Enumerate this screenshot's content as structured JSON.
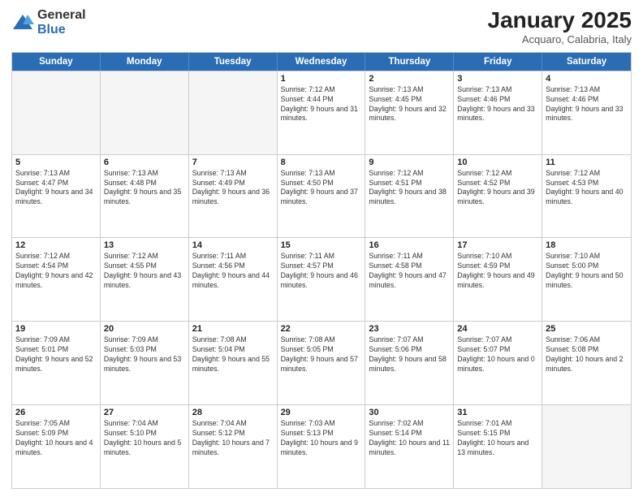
{
  "header": {
    "logo_general": "General",
    "logo_blue": "Blue",
    "month_title": "January 2025",
    "subtitle": "Acquaro, Calabria, Italy"
  },
  "calendar": {
    "days_of_week": [
      "Sunday",
      "Monday",
      "Tuesday",
      "Wednesday",
      "Thursday",
      "Friday",
      "Saturday"
    ],
    "rows": [
      [
        {
          "day": "",
          "info": ""
        },
        {
          "day": "",
          "info": ""
        },
        {
          "day": "",
          "info": ""
        },
        {
          "day": "1",
          "info": "Sunrise: 7:12 AM\nSunset: 4:44 PM\nDaylight: 9 hours and 31 minutes."
        },
        {
          "day": "2",
          "info": "Sunrise: 7:13 AM\nSunset: 4:45 PM\nDaylight: 9 hours and 32 minutes."
        },
        {
          "day": "3",
          "info": "Sunrise: 7:13 AM\nSunset: 4:46 PM\nDaylight: 9 hours and 33 minutes."
        },
        {
          "day": "4",
          "info": "Sunrise: 7:13 AM\nSunset: 4:46 PM\nDaylight: 9 hours and 33 minutes."
        }
      ],
      [
        {
          "day": "5",
          "info": "Sunrise: 7:13 AM\nSunset: 4:47 PM\nDaylight: 9 hours and 34 minutes."
        },
        {
          "day": "6",
          "info": "Sunrise: 7:13 AM\nSunset: 4:48 PM\nDaylight: 9 hours and 35 minutes."
        },
        {
          "day": "7",
          "info": "Sunrise: 7:13 AM\nSunset: 4:49 PM\nDaylight: 9 hours and 36 minutes."
        },
        {
          "day": "8",
          "info": "Sunrise: 7:13 AM\nSunset: 4:50 PM\nDaylight: 9 hours and 37 minutes."
        },
        {
          "day": "9",
          "info": "Sunrise: 7:12 AM\nSunset: 4:51 PM\nDaylight: 9 hours and 38 minutes."
        },
        {
          "day": "10",
          "info": "Sunrise: 7:12 AM\nSunset: 4:52 PM\nDaylight: 9 hours and 39 minutes."
        },
        {
          "day": "11",
          "info": "Sunrise: 7:12 AM\nSunset: 4:53 PM\nDaylight: 9 hours and 40 minutes."
        }
      ],
      [
        {
          "day": "12",
          "info": "Sunrise: 7:12 AM\nSunset: 4:54 PM\nDaylight: 9 hours and 42 minutes."
        },
        {
          "day": "13",
          "info": "Sunrise: 7:12 AM\nSunset: 4:55 PM\nDaylight: 9 hours and 43 minutes."
        },
        {
          "day": "14",
          "info": "Sunrise: 7:11 AM\nSunset: 4:56 PM\nDaylight: 9 hours and 44 minutes."
        },
        {
          "day": "15",
          "info": "Sunrise: 7:11 AM\nSunset: 4:57 PM\nDaylight: 9 hours and 46 minutes."
        },
        {
          "day": "16",
          "info": "Sunrise: 7:11 AM\nSunset: 4:58 PM\nDaylight: 9 hours and 47 minutes."
        },
        {
          "day": "17",
          "info": "Sunrise: 7:10 AM\nSunset: 4:59 PM\nDaylight: 9 hours and 49 minutes."
        },
        {
          "day": "18",
          "info": "Sunrise: 7:10 AM\nSunset: 5:00 PM\nDaylight: 9 hours and 50 minutes."
        }
      ],
      [
        {
          "day": "19",
          "info": "Sunrise: 7:09 AM\nSunset: 5:01 PM\nDaylight: 9 hours and 52 minutes."
        },
        {
          "day": "20",
          "info": "Sunrise: 7:09 AM\nSunset: 5:03 PM\nDaylight: 9 hours and 53 minutes."
        },
        {
          "day": "21",
          "info": "Sunrise: 7:08 AM\nSunset: 5:04 PM\nDaylight: 9 hours and 55 minutes."
        },
        {
          "day": "22",
          "info": "Sunrise: 7:08 AM\nSunset: 5:05 PM\nDaylight: 9 hours and 57 minutes."
        },
        {
          "day": "23",
          "info": "Sunrise: 7:07 AM\nSunset: 5:06 PM\nDaylight: 9 hours and 58 minutes."
        },
        {
          "day": "24",
          "info": "Sunrise: 7:07 AM\nSunset: 5:07 PM\nDaylight: 10 hours and 0 minutes."
        },
        {
          "day": "25",
          "info": "Sunrise: 7:06 AM\nSunset: 5:08 PM\nDaylight: 10 hours and 2 minutes."
        }
      ],
      [
        {
          "day": "26",
          "info": "Sunrise: 7:05 AM\nSunset: 5:09 PM\nDaylight: 10 hours and 4 minutes."
        },
        {
          "day": "27",
          "info": "Sunrise: 7:04 AM\nSunset: 5:10 PM\nDaylight: 10 hours and 5 minutes."
        },
        {
          "day": "28",
          "info": "Sunrise: 7:04 AM\nSunset: 5:12 PM\nDaylight: 10 hours and 7 minutes."
        },
        {
          "day": "29",
          "info": "Sunrise: 7:03 AM\nSunset: 5:13 PM\nDaylight: 10 hours and 9 minutes."
        },
        {
          "day": "30",
          "info": "Sunrise: 7:02 AM\nSunset: 5:14 PM\nDaylight: 10 hours and 11 minutes."
        },
        {
          "day": "31",
          "info": "Sunrise: 7:01 AM\nSunset: 5:15 PM\nDaylight: 10 hours and 13 minutes."
        },
        {
          "day": "",
          "info": ""
        }
      ]
    ]
  }
}
